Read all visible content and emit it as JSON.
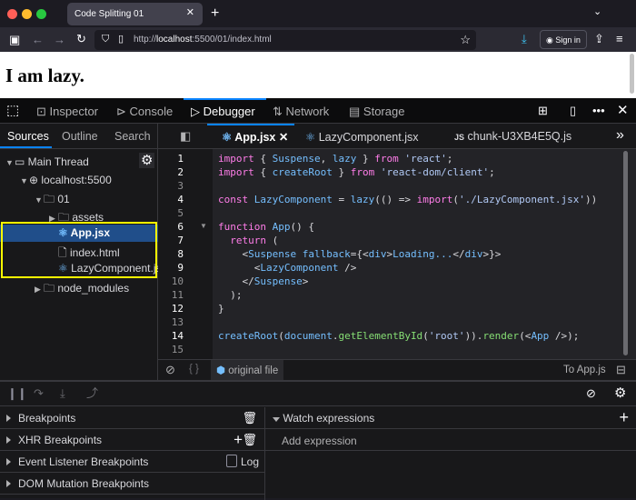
{
  "browser": {
    "tab_title": "Code Splitting 01",
    "url_prefix": "http://",
    "url_host": "localhost",
    "url_rest": ":5500/01/index.html",
    "sign_in": "Sign in"
  },
  "page": {
    "heading": "I am lazy."
  },
  "devtools": {
    "tools": [
      "Inspector",
      "Console",
      "Debugger",
      "Network",
      "Storage"
    ],
    "active_tool": "Debugger"
  },
  "sources": {
    "tabs": [
      "Sources",
      "Outline",
      "Search"
    ],
    "tree": [
      {
        "label": "Main Thread",
        "depth": 0,
        "icon": "window-icon",
        "expanded": true
      },
      {
        "label": "localhost:5500",
        "depth": 1,
        "icon": "globe-icon",
        "expanded": true
      },
      {
        "label": "01",
        "depth": 2,
        "icon": "folder-icon",
        "expanded": true
      },
      {
        "label": "assets",
        "depth": 3,
        "icon": "folder-icon",
        "expanded": false
      },
      {
        "label": "App.jsx",
        "depth": 3,
        "icon": "react-icon",
        "selected": true
      },
      {
        "label": "index.html",
        "depth": 3,
        "icon": "file-icon"
      },
      {
        "label": "LazyComponent.jsx",
        "depth": 3,
        "icon": "react-icon"
      },
      {
        "label": "node_modules",
        "depth": 2,
        "icon": "folder-icon",
        "expanded": false
      }
    ]
  },
  "editor": {
    "tabs": [
      {
        "label": "App.jsx",
        "icon": "react-icon",
        "active": true
      },
      {
        "label": "LazyComponent.jsx",
        "icon": "react-icon"
      },
      {
        "label": "chunk-U3XB4E5Q.js",
        "icon": "js-icon",
        "badge": "JS"
      }
    ],
    "lines": [
      [
        [
          "import",
          "k"
        ],
        [
          " { ",
          "p"
        ],
        [
          "Suspense",
          "i"
        ],
        [
          ", ",
          "p"
        ],
        [
          "lazy",
          "i"
        ],
        [
          " } ",
          "p"
        ],
        [
          "from",
          "k"
        ],
        [
          " ",
          "p"
        ],
        [
          "'react'",
          "s"
        ],
        [
          ";",
          "p"
        ]
      ],
      [
        [
          "import",
          "k"
        ],
        [
          " { ",
          "p"
        ],
        [
          "createRoot",
          "i"
        ],
        [
          " } ",
          "p"
        ],
        [
          "from",
          "k"
        ],
        [
          " ",
          "p"
        ],
        [
          "'react-dom/client'",
          "s"
        ],
        [
          ";",
          "p"
        ]
      ],
      [],
      [
        [
          "const",
          "k"
        ],
        [
          " ",
          "p"
        ],
        [
          "LazyComponent",
          "i"
        ],
        [
          " = ",
          "p"
        ],
        [
          "lazy",
          "i"
        ],
        [
          "(() => ",
          "p"
        ],
        [
          "import",
          "k"
        ],
        [
          "(",
          "p"
        ],
        [
          "'./LazyComponent.jsx'",
          "s"
        ],
        [
          "))",
          "p"
        ]
      ],
      [],
      [
        [
          "function",
          "k"
        ],
        [
          " ",
          "p"
        ],
        [
          "App",
          "i"
        ],
        [
          "() {",
          "p"
        ]
      ],
      [
        [
          "  return",
          "k"
        ],
        [
          " (",
          "p"
        ]
      ],
      [
        [
          "    <",
          "p"
        ],
        [
          "Suspense",
          "t"
        ],
        [
          " ",
          "p"
        ],
        [
          "fallback",
          "i"
        ],
        [
          "={<",
          "p"
        ],
        [
          "div",
          "t"
        ],
        [
          ">",
          "p"
        ],
        [
          "Loading...",
          "i"
        ],
        [
          "</",
          "p"
        ],
        [
          "div",
          "t"
        ],
        [
          ">}>",
          "p"
        ]
      ],
      [
        [
          "      <",
          "p"
        ],
        [
          "LazyComponent",
          "t"
        ],
        [
          " />",
          "p"
        ]
      ],
      [
        [
          "    </",
          "p"
        ],
        [
          "Suspense",
          "t"
        ],
        [
          ">",
          "p"
        ]
      ],
      [
        [
          "  );",
          "p"
        ]
      ],
      [
        [
          "}",
          "p"
        ]
      ],
      [],
      [
        [
          "createRoot",
          "i"
        ],
        [
          "(",
          "p"
        ],
        [
          "document",
          "i"
        ],
        [
          ".",
          "p"
        ],
        [
          "getElementById",
          "f"
        ],
        [
          "(",
          "p"
        ],
        [
          "'root'",
          "s"
        ],
        [
          ")).",
          "p"
        ],
        [
          "render",
          "f"
        ],
        [
          "(<",
          "p"
        ],
        [
          "App",
          "t"
        ],
        [
          " />);",
          "p"
        ]
      ],
      []
    ],
    "footer": {
      "original_file": "original file",
      "to_file": "To App.js",
      "braces": "{ }"
    }
  },
  "bottom": {
    "breakpoints": "Breakpoints",
    "xhr": "XHR Breakpoints",
    "event": "Event Listener Breakpoints",
    "log": "Log",
    "dom": "DOM Mutation Breakpoints",
    "watch": "Watch expressions",
    "add_expression": "Add expression"
  },
  "colors": {
    "accent": "#0a84ff",
    "selection": "#204e8a",
    "highlight_box": "#ffff00"
  }
}
